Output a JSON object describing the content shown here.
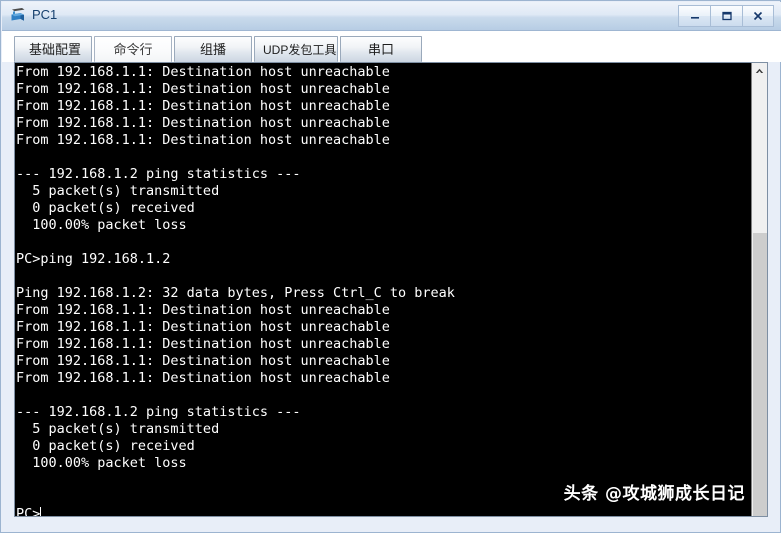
{
  "window": {
    "title": "PC1",
    "icon": "pc-device-icon",
    "controls": [
      {
        "name": "minimize-button",
        "glyph": "minimize-icon"
      },
      {
        "name": "maximize-button",
        "glyph": "maximize-icon"
      },
      {
        "name": "close-button",
        "glyph": "close-icon"
      }
    ]
  },
  "tabs": [
    {
      "label": "基础配置",
      "active": false
    },
    {
      "label": "命令行",
      "active": true
    },
    {
      "label": "组播",
      "active": false
    },
    {
      "label": "UDP发包工具",
      "active": false
    },
    {
      "label": "串口",
      "active": false
    }
  ],
  "terminal": {
    "prompt": "PC>",
    "lines": [
      "From 192.168.1.1: Destination host unreachable",
      "From 192.168.1.1: Destination host unreachable",
      "From 192.168.1.1: Destination host unreachable",
      "From 192.168.1.1: Destination host unreachable",
      "From 192.168.1.1: Destination host unreachable",
      "",
      "--- 192.168.1.2 ping statistics ---",
      "  5 packet(s) transmitted",
      "  0 packet(s) received",
      "  100.00% packet loss",
      "",
      "PC>ping 192.168.1.2",
      "",
      "Ping 192.168.1.2: 32 data bytes, Press Ctrl_C to break",
      "From 192.168.1.1: Destination host unreachable",
      "From 192.168.1.1: Destination host unreachable",
      "From 192.168.1.1: Destination host unreachable",
      "From 192.168.1.1: Destination host unreachable",
      "From 192.168.1.1: Destination host unreachable",
      "",
      "--- 192.168.1.2 ping statistics ---",
      "  5 packet(s) transmitted",
      "  0 packet(s) received",
      "  100.00% packet loss",
      "",
      ""
    ],
    "current_input": "",
    "background_color": "#000000",
    "text_color": "#ffffff"
  },
  "scrollbar": {
    "up_arrow": "chevron-up-icon",
    "thumb_position": "bottom"
  },
  "watermark": {
    "text": "头条 @攻城狮成长日记"
  }
}
